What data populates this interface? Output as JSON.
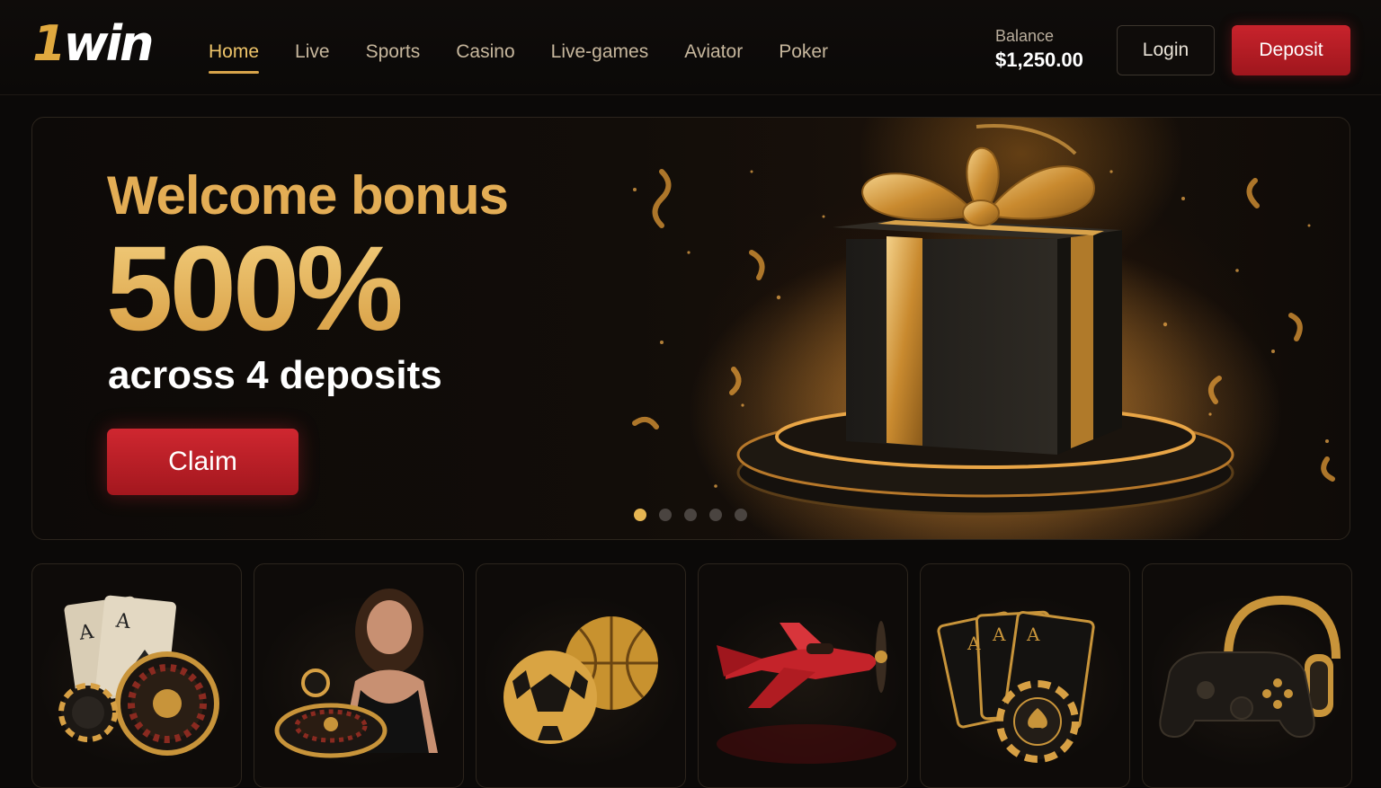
{
  "header": {
    "logo_one": "1",
    "logo_win": "win",
    "nav": [
      {
        "label": "Home",
        "active": true
      },
      {
        "label": "Live"
      },
      {
        "label": "Sports"
      },
      {
        "label": "Casino"
      },
      {
        "label": "Live-games"
      },
      {
        "label": "Aviator"
      },
      {
        "label": "Poker"
      }
    ],
    "balance_label": "Balance",
    "balance_value": "$1,250.00",
    "login_label": "Login",
    "deposit_label": "Deposit"
  },
  "hero": {
    "title": "Welcome bonus",
    "percent": "500%",
    "subtitle": "across 4 deposits",
    "claim_label": "Claim",
    "slides_total": 5,
    "active_slide": 0
  },
  "cards": [
    {
      "icon": "cards-roulette-icon"
    },
    {
      "icon": "live-dealer-icon"
    },
    {
      "icon": "sports-balls-icon"
    },
    {
      "icon": "aviator-plane-icon"
    },
    {
      "icon": "poker-cards-chip-icon"
    },
    {
      "icon": "gamepad-headphones-icon"
    }
  ],
  "colors": {
    "gold": "#e3ad55",
    "red": "#c8232c",
    "background": "#0b0908"
  }
}
